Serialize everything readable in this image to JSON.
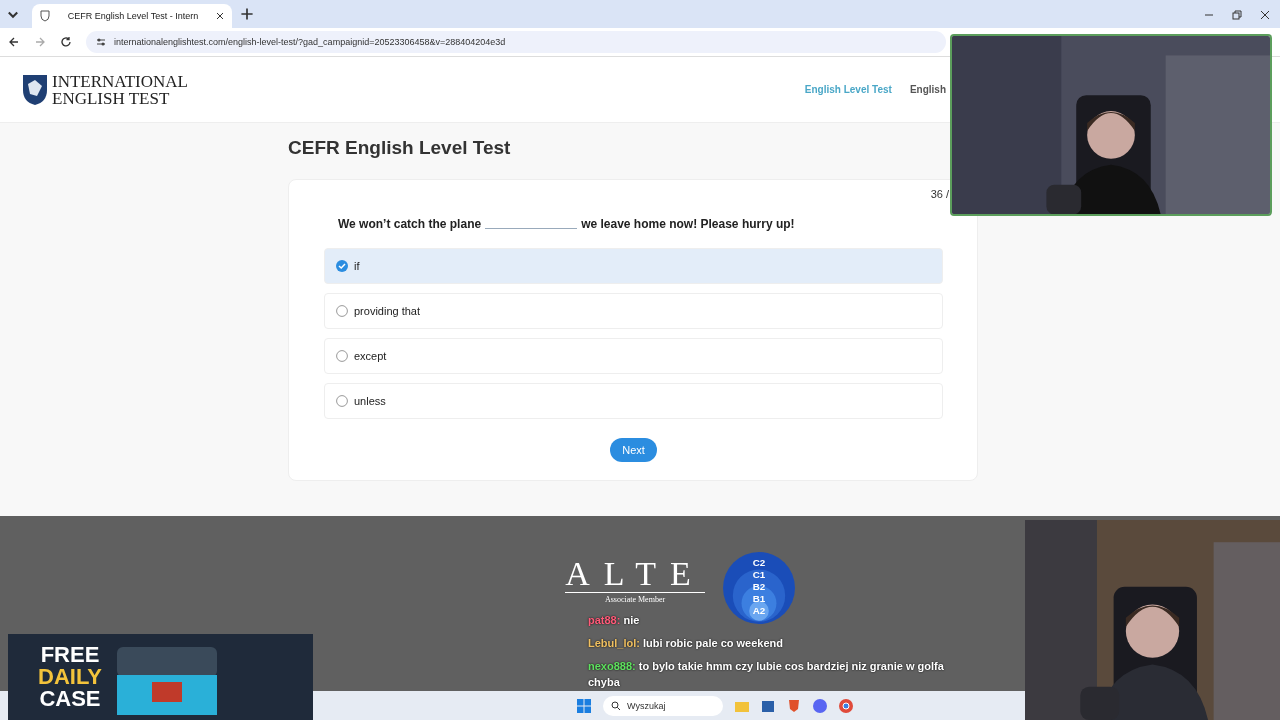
{
  "browser": {
    "tab": {
      "title": "CEFR English Level Test - Intern"
    },
    "url": "internationalenglishtest.com/english-level-test/?gad_campaignid=20523306458&v=288404204e3d"
  },
  "site": {
    "logo": [
      "INTERNATIONAL",
      "ENGLISH TEST"
    ],
    "nav": [
      {
        "label": "English Level Test",
        "selected": true
      },
      {
        "label": "English",
        "selected": false
      }
    ]
  },
  "page_title": "CEFR English Level Test",
  "quiz": {
    "progress": "36 /",
    "question_before": "We won’t catch the plane",
    "question_after": "we leave home now! Please hurry up!",
    "options": [
      {
        "label": "if",
        "selected": true
      },
      {
        "label": "providing that",
        "selected": false
      },
      {
        "label": "except",
        "selected": false
      },
      {
        "label": "unless",
        "selected": false
      }
    ],
    "next": "Next"
  },
  "footer": {
    "badge": {
      "name": "ALTE",
      "caption": "Associate Member",
      "levels": [
        "C2",
        "C1",
        "B2",
        "B1",
        "A2"
      ]
    }
  },
  "overlays": {
    "ad": {
      "lines": [
        "FREE",
        "DAILY",
        "CASE"
      ]
    },
    "chat": [
      {
        "user": "pat88:",
        "color": "#ff5a78",
        "text": "nie"
      },
      {
        "user": "Lebul_lol:",
        "color": "#f0c060",
        "text": "lubi robic pale co weekend"
      },
      {
        "user": "nexo888:",
        "color": "#5ee05e",
        "text": "to bylo takie hmm czy lubie cos bardziej niz granie w golfa chyba"
      }
    ]
  },
  "taskbar": {
    "search_placeholder": "Wyszukaj"
  }
}
